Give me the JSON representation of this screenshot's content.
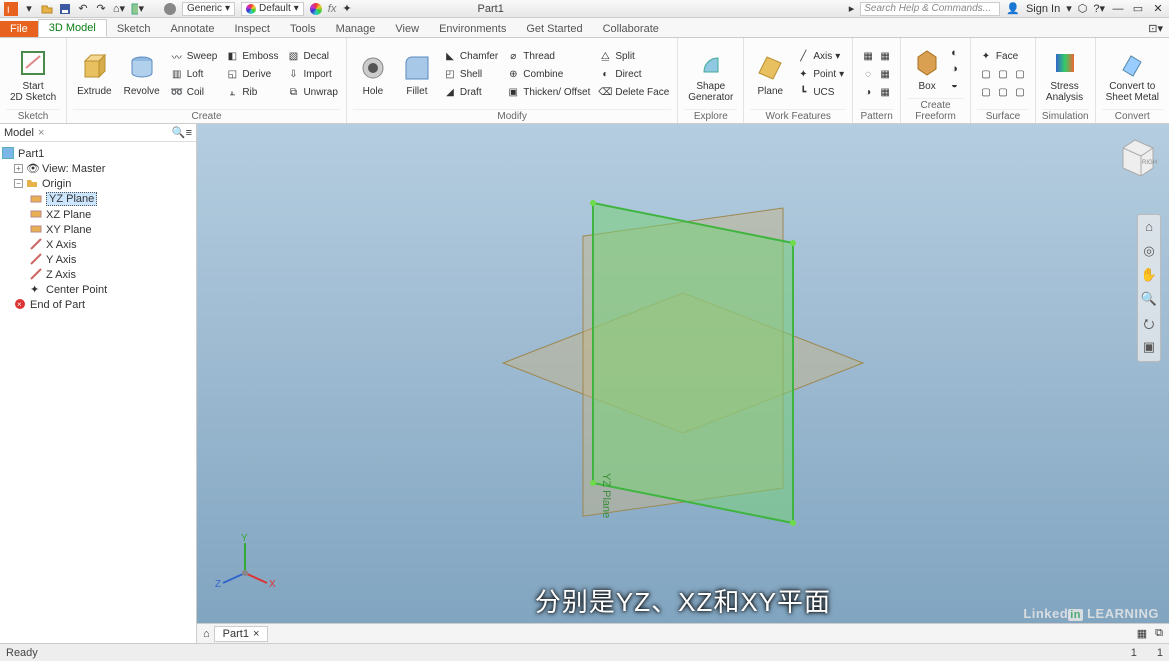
{
  "titlebar": {
    "generic_label": "Generic",
    "default_label": "Default",
    "part_name": "Part1",
    "search_placeholder": "Search Help & Commands...",
    "signin": "Sign In"
  },
  "tabs": {
    "file": "File",
    "items": [
      "3D Model",
      "Sketch",
      "Annotate",
      "Inspect",
      "Tools",
      "Manage",
      "View",
      "Environments",
      "Get Started",
      "Collaborate"
    ],
    "active_index": 0
  },
  "ribbon": {
    "sketch": {
      "start": "Start\n2D Sketch",
      "label": "Sketch"
    },
    "create": {
      "extrude": "Extrude",
      "revolve": "Revolve",
      "sweep": "Sweep",
      "loft": "Loft",
      "coil": "Coil",
      "emboss": "Emboss",
      "derive": "Derive",
      "rib": "Rib",
      "decal": "Decal",
      "import": "Import",
      "unwrap": "Unwrap",
      "label": "Create"
    },
    "modify": {
      "hole": "Hole",
      "fillet": "Fillet",
      "chamfer": "Chamfer",
      "shell": "Shell",
      "draft": "Draft",
      "thread": "Thread",
      "combine": "Combine",
      "thicken": "Thicken/ Offset",
      "split": "Split",
      "direct": "Direct",
      "deleteface": "Delete Face",
      "label": "Modify"
    },
    "explore": {
      "shapegen": "Shape\nGenerator",
      "label": "Explore"
    },
    "workfeat": {
      "plane": "Plane",
      "axis": "Axis",
      "point": "Point",
      "ucs": "UCS",
      "label": "Work Features"
    },
    "pattern": {
      "label": "Pattern"
    },
    "freeform": {
      "box": "Box",
      "label": "Create Freeform"
    },
    "surface": {
      "face": "Face",
      "label": "Surface"
    },
    "sim": {
      "stress": "Stress\nAnalysis",
      "label": "Simulation"
    },
    "convert": {
      "sheet": "Convert to\nSheet Metal",
      "label": "Convert"
    }
  },
  "browser": {
    "title": "Model",
    "root": "Part1",
    "view": "View: Master",
    "origin": "Origin",
    "planes": [
      "YZ Plane",
      "XZ Plane",
      "XY Plane"
    ],
    "axes": [
      "X Axis",
      "Y Axis",
      "Z Axis"
    ],
    "center": "Center Point",
    "end": "End of Part"
  },
  "viewport": {
    "doc_tab": "Part1",
    "plane_label": "YZ Plane",
    "triad": {
      "x": "X",
      "y": "Y",
      "z": "Z"
    }
  },
  "status": {
    "ready": "Ready",
    "n1": "1",
    "n2": "1"
  },
  "subtitle": "分别是YZ、XZ和XY平面",
  "watermark": "Linked in LEARNING"
}
